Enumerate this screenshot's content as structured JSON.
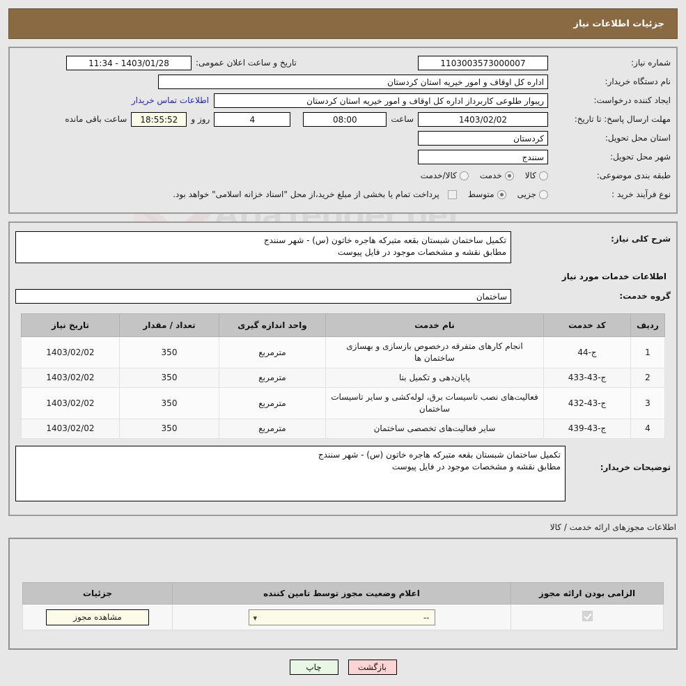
{
  "header": {
    "title": "جزئیات اطلاعات نیاز"
  },
  "watermark": {
    "text": "AriaTender.net"
  },
  "summary": {
    "need_number_label": "شماره نیاز:",
    "need_number_value": "1103003573000007",
    "announce_label": "تاریخ و ساعت اعلان عمومی:",
    "announce_value": "1403/01/28 - 11:34",
    "buyer_org_label": "نام دستگاه خریدار:",
    "buyer_org_value": "اداره کل اوقاف و امور خیریه استان کردستان",
    "requester_label": "ایجاد کننده درخواست:",
    "requester_value": "ریبوار طلوعی کاربرداز اداره کل اوقاف و امور خیریه استان کردستان",
    "contact_link": "اطلاعات تماس خریدار",
    "deadline_label": "مهلت ارسال پاسخ: تا تاریخ:",
    "deadline_date": "1403/02/02",
    "time_label": "ساعت",
    "deadline_time": "08:00",
    "days_remaining": "4",
    "days_unit_label": "روز و",
    "countdown": "18:55:52",
    "countdown_suffix": "ساعت باقی مانده",
    "province_label": "استان محل تحویل:",
    "province_value": "کردستان",
    "city_label": "شهر محل تحویل:",
    "city_value": "سنندج",
    "category_label": "طبقه بندی موضوعی:",
    "category_options": [
      {
        "label": "کالا",
        "selected": false
      },
      {
        "label": "خدمت",
        "selected": true
      },
      {
        "label": "کالا/خدمت",
        "selected": false
      }
    ],
    "process_label": "نوع فرآیند خرید :",
    "process_options": [
      {
        "label": "جزیی",
        "selected": false
      },
      {
        "label": "متوسط",
        "selected": true
      }
    ],
    "treasury_checkbox_checked": false,
    "treasury_note": "پرداخت تمام یا بخشی از مبلغ خرید،از محل \"اسناد خزانه اسلامی\" خواهد بود."
  },
  "need": {
    "general_desc_label": "شرح کلی نیاز:",
    "general_desc_value": "تکمیل ساختمان شبستان بقعه متبرکه هاجره خاتون (س) - شهر سنندج\nمطابق نقشه و مشخصات موجود در فایل پیوست",
    "services_caption": "اطلاعات خدمات مورد نیاز",
    "service_group_label": "گروه خدمت:",
    "service_group_value": "ساختمان",
    "table": {
      "headers": [
        "ردیف",
        "کد خدمت",
        "نام خدمت",
        "واحد اندازه گیری",
        "تعداد / مقدار",
        "تاریخ نیاز"
      ],
      "rows": [
        {
          "row": "1",
          "code": "ج-44",
          "name": "انجام کارهای متفرقه درخصوص بازسازی و بهسازی ساختمان ها",
          "unit": "مترمربع",
          "qty": "350",
          "date": "1403/02/02"
        },
        {
          "row": "2",
          "code": "ج-43-433",
          "name": "پایان‌دهی و تکمیل بنا",
          "unit": "مترمربع",
          "qty": "350",
          "date": "1403/02/02"
        },
        {
          "row": "3",
          "code": "ج-43-432",
          "name": "فعالیت‌های نصب تاسیسات برق، لوله‌کشی و سایر تاسیسات ساختمان",
          "unit": "مترمربع",
          "qty": "350",
          "date": "1403/02/02"
        },
        {
          "row": "4",
          "code": "ج-43-439",
          "name": "سایر فعالیت‌های تخصصی ساختمان",
          "unit": "مترمربع",
          "qty": "350",
          "date": "1403/02/02"
        }
      ]
    },
    "buyer_notes_label": "توضیحات خریدار:",
    "buyer_notes_value": "تکمیل ساختمان شبستان بقعه متبرکه هاجره خاتون (س) - شهر سنندج\nمطابق نقشه و مشخصات موجود در فایل پیوست"
  },
  "permits": {
    "caption": "اطلاعات مجوزهای ارائه خدمت / کالا",
    "headers": [
      "الزامی بودن ارائه مجوز",
      "اعلام وضعیت مجوز توسط تامین کننده",
      "جزئیات"
    ],
    "row": {
      "required_checked": true,
      "status_value": "--",
      "details_button": "مشاهده مجوز"
    }
  },
  "footer": {
    "back_label": "بازگشت",
    "print_label": "چاپ"
  }
}
